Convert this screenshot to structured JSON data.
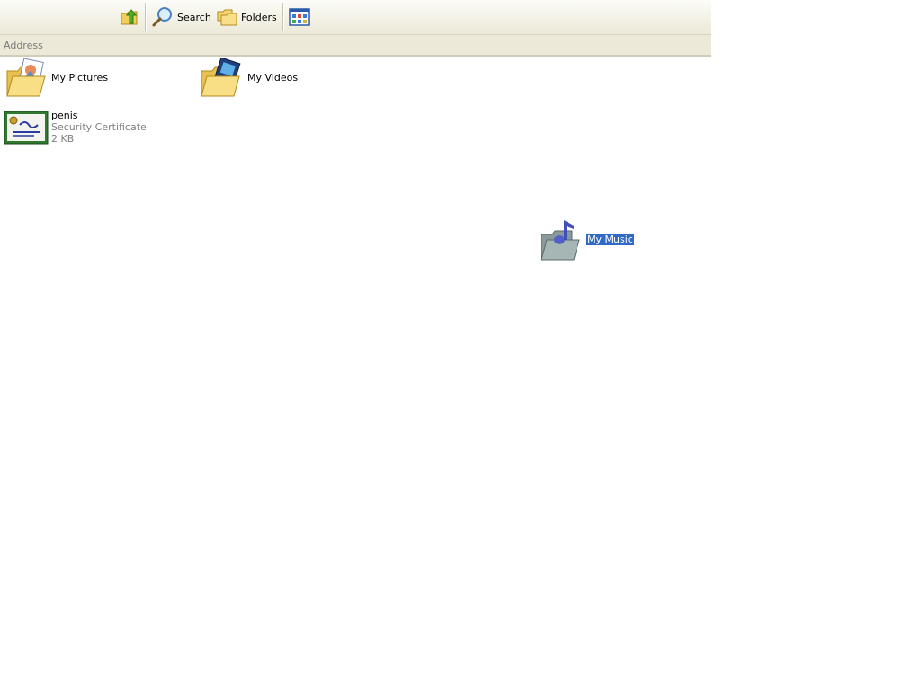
{
  "toolbar": {
    "up_icon": "folder-up-icon",
    "search_label": "Search",
    "folders_label": "Folders",
    "views_icon": "views-icon"
  },
  "addressbar": {
    "label": "Address"
  },
  "items": [
    {
      "name": "My Pictures",
      "icon": "my-pictures-folder-icon"
    },
    {
      "name": "My Videos",
      "icon": "my-videos-folder-icon"
    },
    {
      "name": "penis",
      "type": "Security Certificate",
      "size": "2 KB",
      "icon": "security-certificate-icon"
    },
    {
      "name": "My Music",
      "icon": "my-music-folder-icon",
      "selected": true
    }
  ],
  "colors": {
    "selection": "#316ac5",
    "toolbar_bg": "#ece9d8",
    "folder_yellow": "#f5d76e"
  }
}
